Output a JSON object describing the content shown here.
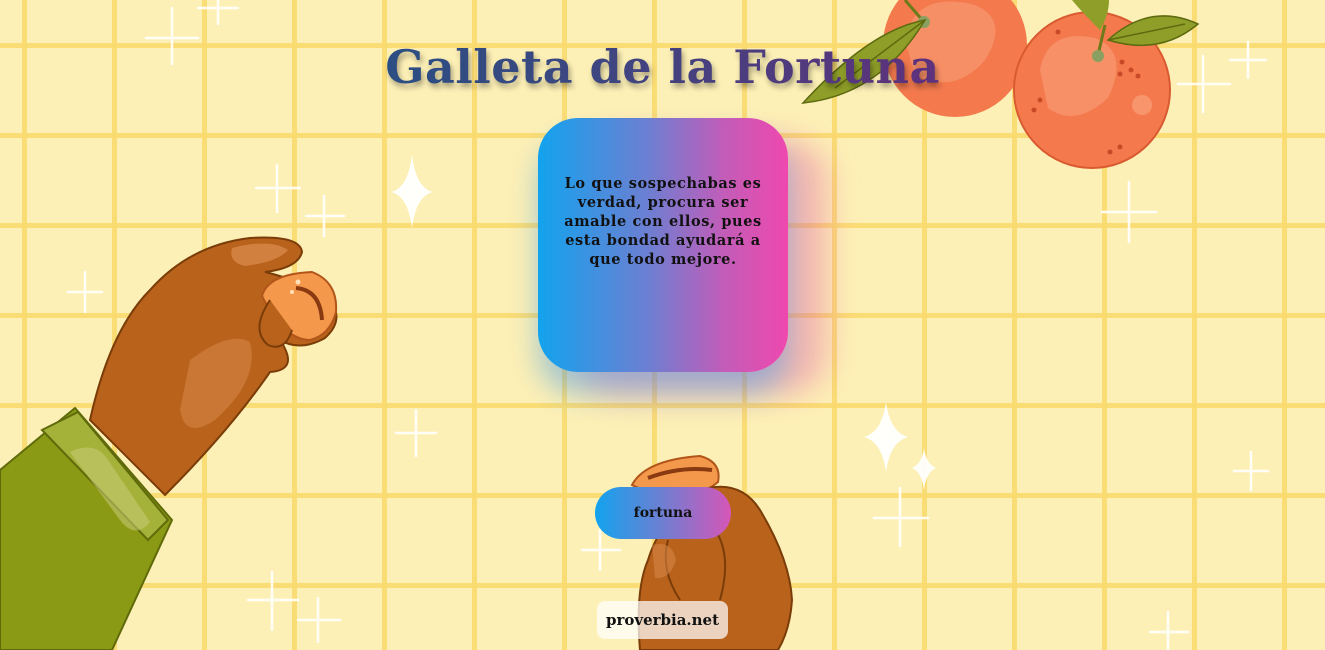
{
  "app": {
    "title": "Galleta de la Fortuna"
  },
  "fortune": {
    "message": "Lo que sospechabas es verdad, procura ser amable con ellos, pues esta bondad ayudará a que todo mejore."
  },
  "controls": {
    "fortune_button_label": "fortuna"
  },
  "footer": {
    "link_text": "proverbia.net"
  },
  "icons": [
    "orange-fruit-icon",
    "hand-left-icon",
    "hand-right-icon",
    "cookie-piece-icon",
    "sparkle-icon"
  ],
  "colors": {
    "background": "#fdf0b6",
    "grid": "#fada6e",
    "gradient_start": "#12a3ee",
    "gradient_end": "#ef48ae",
    "orange": "#f57d50",
    "skin": "#b8621b",
    "sleeve": "#8a9a14"
  }
}
